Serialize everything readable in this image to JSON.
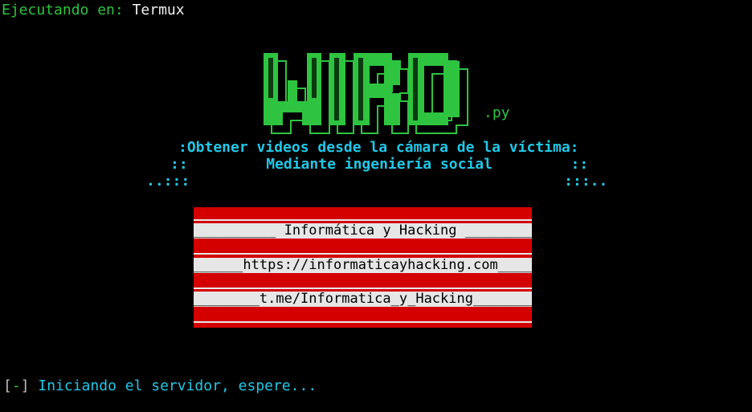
{
  "header": {
    "label": "Ejecutando en:",
    "value": "Termux"
  },
  "logo": {
    "text": "WIRD",
    "suffix": ".py",
    "color": "#2ec43f"
  },
  "subtitle": {
    "line1": ":Obtener videos desde la cámara de la víctima:",
    "line2": "::         Mediante ingeniería social         ::",
    "line3": "..:::                                           :::.."
  },
  "banner": {
    "background": "#d40000",
    "rows": [
      "__________ Informática y Hacking __________",
      "______https://informaticayhacking.com_____",
      "________t.me/Informatica_y_Hacking________"
    ]
  },
  "status": {
    "prefix_open": "[",
    "prefix_mark": "-",
    "prefix_close": "]",
    "message": " Iniciando el servidor, espere..."
  }
}
